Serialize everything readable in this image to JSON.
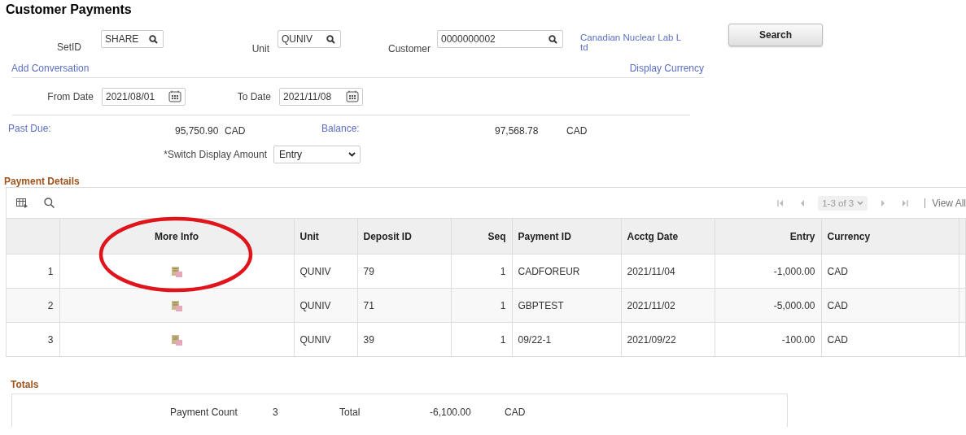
{
  "title": "Customer Payments",
  "setid": {
    "label": "SetID",
    "value": "SHARE"
  },
  "unit": {
    "label": "Unit",
    "value": "QUNIV"
  },
  "customer": {
    "label": "Customer",
    "value": "0000000002",
    "name": "Canadian Nuclear Lab Ltd"
  },
  "search_button": "Search",
  "add_conversation": "Add Conversation",
  "display_currency": "Display Currency",
  "from_date": {
    "label": "From Date",
    "value": "2021/08/01"
  },
  "to_date": {
    "label": "To Date",
    "value": "2021/11/08"
  },
  "past_due": {
    "label": "Past Due:",
    "amount": "95,750.90",
    "currency": "CAD"
  },
  "balance": {
    "label": "Balance:",
    "amount": "97,568.78",
    "currency": "CAD"
  },
  "switch_display": {
    "label": "*Switch Display Amount",
    "value": "Entry"
  },
  "payment_details": {
    "title": "Payment Details",
    "pagination": "1-3 of 3",
    "view_all": "View All",
    "columns": [
      "More Info",
      "Unit",
      "Deposit ID",
      "Seq",
      "Payment ID",
      "Acctg Date",
      "Entry",
      "Currency"
    ],
    "rows": [
      {
        "row": "1",
        "unit": "QUNIV",
        "deposit_id": "79",
        "seq": "1",
        "payment_id": "CADFOREUR",
        "acctg_date": "2021/11/04",
        "entry": "-1,000.00",
        "currency": "CAD"
      },
      {
        "row": "2",
        "unit": "QUNIV",
        "deposit_id": "71",
        "seq": "1",
        "payment_id": "GBPTEST",
        "acctg_date": "2021/11/02",
        "entry": "-5,000.00",
        "currency": "CAD"
      },
      {
        "row": "3",
        "unit": "QUNIV",
        "deposit_id": "39",
        "seq": "1",
        "payment_id": "09/22-1",
        "acctg_date": "2021/09/22",
        "entry": "-100.00",
        "currency": "CAD"
      }
    ]
  },
  "totals": {
    "title": "Totals",
    "count_label": "Payment Count",
    "count": "3",
    "total_label": "Total",
    "total": "-6,100.00",
    "currency": "CAD"
  }
}
